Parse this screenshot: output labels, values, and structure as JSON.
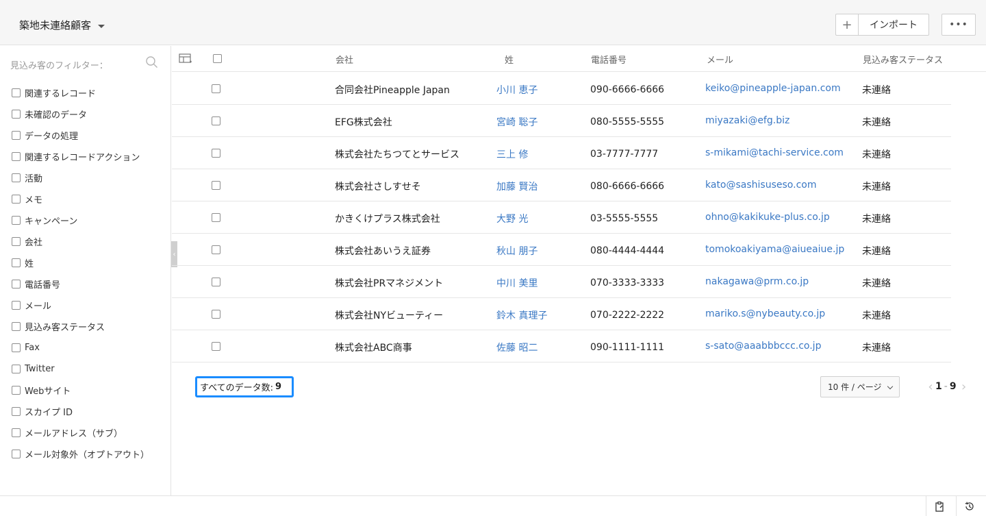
{
  "header": {
    "view_title": "築地未連絡顧客",
    "plus_label": "+",
    "import_label": "インポート",
    "more_label": "•••"
  },
  "sidebar": {
    "filter_title": "見込み客のフィルター：",
    "items": [
      {
        "label": "関連するレコード"
      },
      {
        "label": "未確認のデータ"
      },
      {
        "label": "データの処理"
      },
      {
        "label": "関連するレコードアクション"
      },
      {
        "label": "活動"
      },
      {
        "label": "メモ"
      },
      {
        "label": "キャンペーン"
      },
      {
        "label": "会社"
      },
      {
        "label": "姓"
      },
      {
        "label": "電話番号"
      },
      {
        "label": "メール"
      },
      {
        "label": "見込み客ステータス"
      },
      {
        "label": "Fax"
      },
      {
        "label": "Twitter"
      },
      {
        "label": "Webサイト"
      },
      {
        "label": "スカイプ ID"
      },
      {
        "label": "メールアドレス（サブ）"
      },
      {
        "label": "メール対象外（オプトアウト）"
      }
    ]
  },
  "table": {
    "columns": {
      "company": "会社",
      "last_name": "姓",
      "phone": "電話番号",
      "email": "メール",
      "status": "見込み客ステータス"
    },
    "rows": [
      {
        "company": "合同会社Pineapple Japan",
        "name": "小川 恵子",
        "phone": "090-6666-6666",
        "email": "keiko@pineapple-japan.com",
        "status": "未連絡"
      },
      {
        "company": "EFG株式会社",
        "name": "宮崎 聡子",
        "phone": "080-5555-5555",
        "email": "miyazaki@efg.biz",
        "status": "未連絡"
      },
      {
        "company": "株式会社たちつてとサービス",
        "name": "三上 修",
        "phone": "03-7777-7777",
        "email": "s-mikami@tachi-service.com",
        "status": "未連絡"
      },
      {
        "company": "株式会社さしすせそ",
        "name": "加藤 賢治",
        "phone": "080-6666-6666",
        "email": "kato@sashisuseso.com",
        "status": "未連絡"
      },
      {
        "company": "かきくけプラス株式会社",
        "name": "大野 光",
        "phone": "03-5555-5555",
        "email": "ohno@kakikuke-plus.co.jp",
        "status": "未連絡"
      },
      {
        "company": "株式会社あいうえ証券",
        "name": "秋山 朋子",
        "phone": "080-4444-4444",
        "email": "tomokoakiyama@aiueaiue.jp",
        "status": "未連絡"
      },
      {
        "company": "株式会社PRマネジメント",
        "name": "中川 美里",
        "phone": "070-3333-3333",
        "email": "nakagawa@prm.co.jp",
        "status": "未連絡"
      },
      {
        "company": "株式会社NYビューティー",
        "name": "鈴木 真理子",
        "phone": "070-2222-2222",
        "email": "mariko.s@nybeauty.co.jp",
        "status": "未連絡"
      },
      {
        "company": "株式会社ABC商事",
        "name": "佐藤 昭二",
        "phone": "090-1111-1111",
        "email": "s-sato@aaabbbccc.co.jp",
        "status": "未連絡"
      }
    ],
    "total_label": "すべてのデータ数:",
    "total_count": "9",
    "per_page": "10 件 / ページ",
    "page_start": "1",
    "page_sep": "-",
    "page_end": "9"
  },
  "colors": {
    "link": "#3a78c4",
    "highlight": "#1a8cff"
  }
}
